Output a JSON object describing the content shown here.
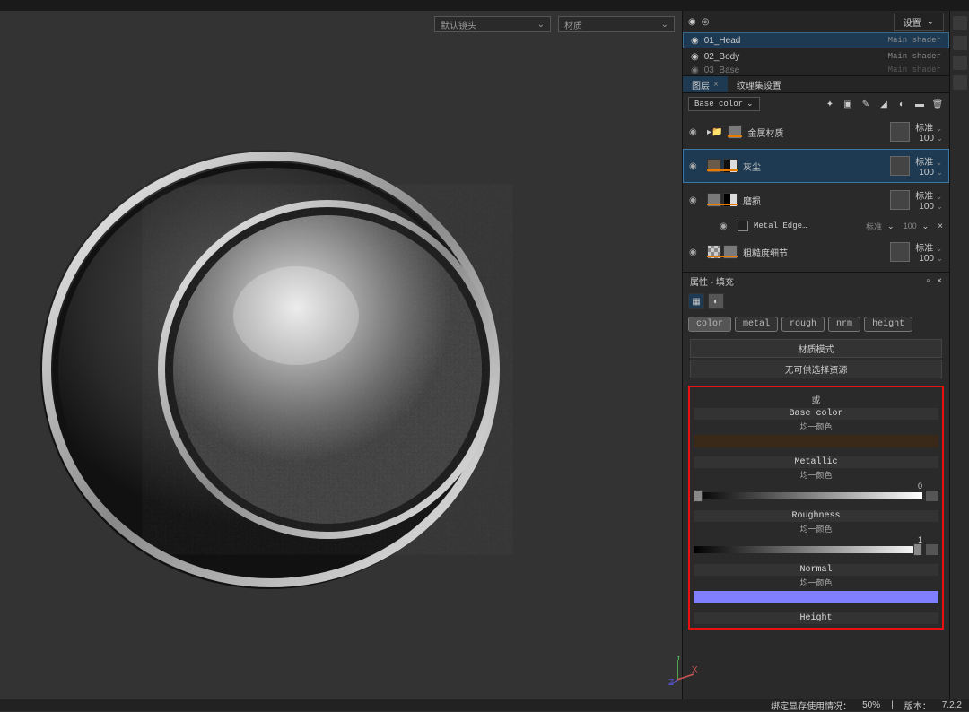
{
  "viewport": {
    "camera": "默认镜头",
    "category": "材质"
  },
  "right": {
    "settings": "设置",
    "texture_sets": [
      {
        "name": "01_Head",
        "shader": "Main shader",
        "active": true
      },
      {
        "name": "02_Body",
        "shader": "Main shader",
        "active": false
      },
      {
        "name": "03_Base",
        "shader": "Main shader",
        "active": false
      }
    ],
    "tabs": {
      "layers": "图层",
      "texset": "纹理集设置"
    },
    "channel": "Base color",
    "layers": [
      {
        "name": "金属材质",
        "mode": "标准",
        "opacity": "100",
        "type": "folder"
      },
      {
        "name": "灰尘",
        "mode": "标准",
        "opacity": "100",
        "type": "fill",
        "selected": true
      },
      {
        "name": "磨损",
        "mode": "标准",
        "opacity": "100",
        "type": "fill"
      },
      {
        "name": "Metal Edge…",
        "mode": "标准",
        "opacity": "100",
        "type": "sub"
      },
      {
        "name": "粗糙度细节",
        "mode": "标准",
        "opacity": "100",
        "type": "fill"
      }
    ]
  },
  "props": {
    "title": "属性 - 填充",
    "chips": [
      "color",
      "metal",
      "rough",
      "nrm",
      "height"
    ],
    "material_mode": "材质模式",
    "no_resource": "无可供选择资源",
    "or": "或",
    "uniform": "均一颜色",
    "channels": {
      "base": "Base color",
      "metallic": "Metallic",
      "metallic_val": "0",
      "roughness": "Roughness",
      "rough_val": "1",
      "normal": "Normal",
      "height": "Height"
    }
  },
  "status": {
    "mem": "绑定显存使用情况：",
    "pct": "50%",
    "ver_label": "版本：",
    "ver": "7.2.2"
  }
}
